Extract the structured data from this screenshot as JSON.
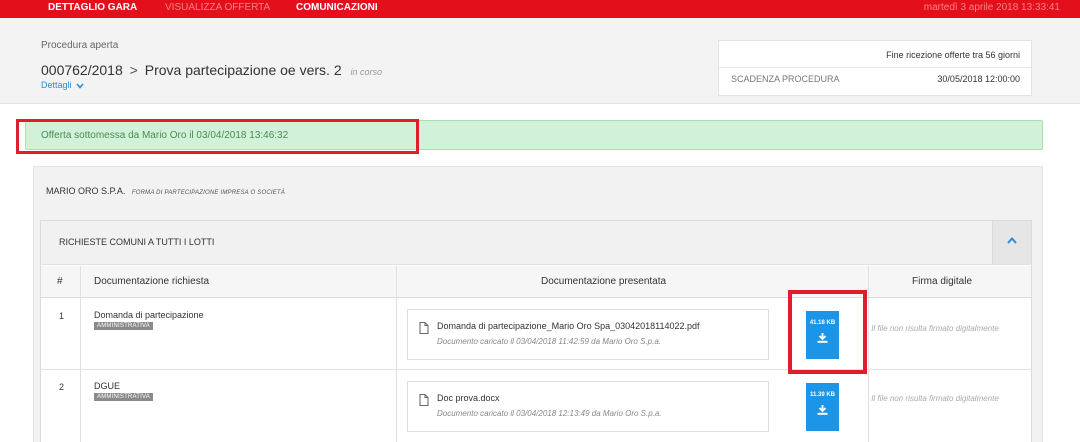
{
  "nav": {
    "tab_detail": "DETTAGLIO GARA",
    "tab_view_offer": "VISUALIZZA OFFERTA",
    "tab_communications": "COMUNICAZIONI",
    "date": "martedì 3 aprile 2018 13:33:41"
  },
  "header": {
    "procedure_type": "Procedura aperta",
    "code": "000762/2018",
    "separator": ">",
    "title": "Prova partecipazione oe vers. 2",
    "status": "in corso",
    "details_link": "Dettagli"
  },
  "deadline": {
    "receipt_text": "Fine ricezione offerte tra 56 giorni",
    "label": "SCADENZA PROCEDURA",
    "value": "30/05/2018 12:00:00"
  },
  "alert": {
    "message": "Offerta sottomessa da Mario Oro il 03/04/2018 13:46:32"
  },
  "company": {
    "name": "MARIO ORO S.P.A.",
    "form": "FORMA DI PARTECIPAZIONE IMPRESA O SOCIETÀ"
  },
  "section": {
    "title": "RICHIESTE COMUNI A TUTTI I LOTTI"
  },
  "table": {
    "headers": [
      "#",
      "Documentazione richiesta",
      "Documentazione presentata",
      "Firma digitale"
    ],
    "rows": [
      {
        "num": "1",
        "name": "Domanda di partecipazione",
        "badge": "AMMINISTRATIVA",
        "file": "Domanda di partecipazione_Mario Oro Spa_03042018114022.pdf",
        "uploaded": "Documento caricato il 03/04/2018 11:42:59 da Mario Oro S.p.a.",
        "size": "41.18 KB",
        "signature": "Il file non risulta firmato digitalmente"
      },
      {
        "num": "2",
        "name": "DGUE",
        "badge": "AMMINISTRATIVA",
        "file": "Doc prova.docx",
        "uploaded": "Documento caricato il 03/04/2018 12:13:49 da Mario Oro S.p.a.",
        "size": "11.39 KB",
        "signature": "Il file non risulta firmato digitalmente"
      }
    ]
  },
  "colors": {
    "brand_red": "#e3101c",
    "success_bg": "#d1f2d8",
    "download_blue": "#1a95e8",
    "highlight_red": "#e01e2b"
  }
}
